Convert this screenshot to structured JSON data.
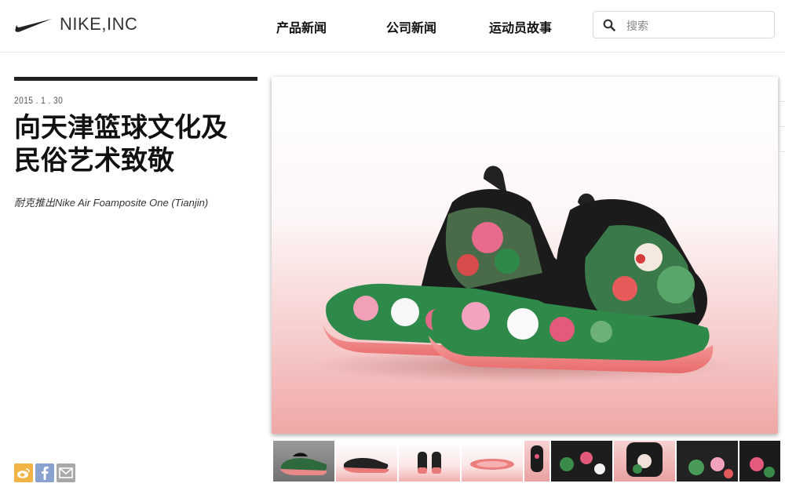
{
  "header": {
    "logo_text": "NIKE,INC",
    "nav": [
      "产品新闻",
      "公司新闻",
      "运动员故事"
    ],
    "search_placeholder": "搜索"
  },
  "article": {
    "date": "2015 . 1 . 30",
    "title_line1": "向天津篮球文化及",
    "title_line2": "民俗艺术致敬",
    "subtitle": "耐克推出Nike Air Foamposite One (Tianjin)"
  },
  "colors": {
    "brand": "#111111",
    "accent": "#f07b2c",
    "sole_pink": "#f07b7b",
    "weibo": "#f2b545",
    "facebook": "#8aa2cf",
    "mail": "#a8a8a8"
  },
  "share": [
    "weibo-icon",
    "facebook-icon",
    "mail-icon"
  ],
  "gallery": {
    "thumbnail_count": 9,
    "active_index": 0
  }
}
